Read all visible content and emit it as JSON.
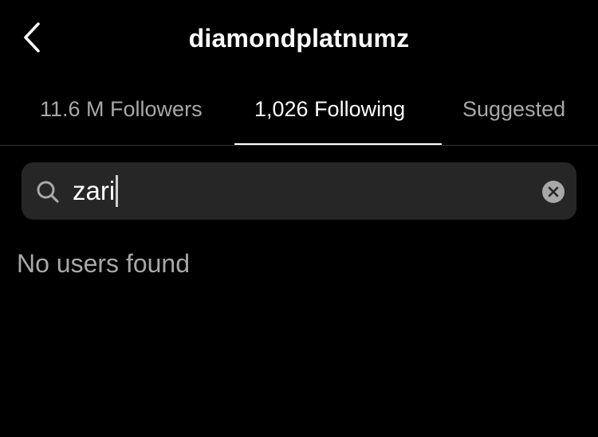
{
  "header": {
    "title": "diamondplatnumz",
    "back_icon": "chevron-left-icon"
  },
  "tabs": [
    {
      "label": "11.6 M Followers",
      "active": false
    },
    {
      "label": "1,026 Following",
      "active": true
    },
    {
      "label": "Suggested",
      "active": false
    }
  ],
  "search": {
    "value": "zari",
    "icon": "search-icon",
    "clear_icon": "clear-icon"
  },
  "results": {
    "empty_message": "No users found"
  },
  "colors": {
    "background": "#000000",
    "text_primary": "#ffffff",
    "text_secondary": "#a8a8a8",
    "search_field": "#262626",
    "divider": "#363636"
  }
}
